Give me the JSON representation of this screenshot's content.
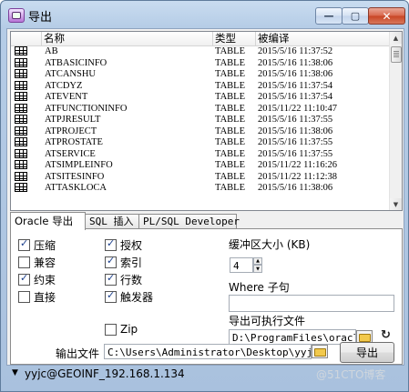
{
  "window": {
    "title": "导出",
    "min_glyph": "—",
    "max_glyph": "▢",
    "close_glyph": "✕"
  },
  "table": {
    "columns": [
      "名称",
      "类型",
      "被编译"
    ],
    "rows": [
      {
        "name": "AB",
        "type": "TABLE",
        "compiled": "2015/5/16 11:37:52"
      },
      {
        "name": "ATBASICINFO",
        "type": "TABLE",
        "compiled": "2015/5/16 11:38:06"
      },
      {
        "name": "ATCANSHU",
        "type": "TABLE",
        "compiled": "2015/5/16 11:38:06"
      },
      {
        "name": "ATCDYZ",
        "type": "TABLE",
        "compiled": "2015/5/16 11:37:54"
      },
      {
        "name": "ATEVENT",
        "type": "TABLE",
        "compiled": "2015/5/16 11:37:54"
      },
      {
        "name": "ATFUNCTIONINFO",
        "type": "TABLE",
        "compiled": "2015/11/22 11:10:47"
      },
      {
        "name": "ATPJRESULT",
        "type": "TABLE",
        "compiled": "2015/5/16 11:37:55"
      },
      {
        "name": "ATPROJECT",
        "type": "TABLE",
        "compiled": "2015/5/16 11:38:06"
      },
      {
        "name": "ATPROSTATE",
        "type": "TABLE",
        "compiled": "2015/5/16 11:37:55"
      },
      {
        "name": "ATSERVICE",
        "type": "TABLE",
        "compiled": "2015/5/16 11:37:55"
      },
      {
        "name": "ATSIMPLEINFO",
        "type": "TABLE",
        "compiled": "2015/11/22 11:16:26"
      },
      {
        "name": "ATSITESINFO",
        "type": "TABLE",
        "compiled": "2015/11/22 11:12:38"
      },
      {
        "name": "ATTASKLOCA",
        "type": "TABLE",
        "compiled": "2015/5/16 11:38:06"
      }
    ]
  },
  "tabs": [
    "Oracle 导出",
    "SQL 插入",
    "PL/SQL Developer"
  ],
  "options": {
    "compress": {
      "label": "压缩",
      "checked": true
    },
    "compatible": {
      "label": "兼容",
      "checked": false
    },
    "constraints": {
      "label": "约束",
      "checked": true
    },
    "direct": {
      "label": "直接",
      "checked": false
    },
    "grants": {
      "label": "授权",
      "checked": true
    },
    "indexes": {
      "label": "索引",
      "checked": true
    },
    "rows": {
      "label": "行数",
      "checked": true
    },
    "triggers": {
      "label": "触发器",
      "checked": true
    },
    "zip": {
      "label": "Zip",
      "checked": false
    }
  },
  "buffer": {
    "label": "缓冲区大小 (KB)",
    "value": "4"
  },
  "where": {
    "label": "Where 子句",
    "value": ""
  },
  "executable": {
    "label": "导出可执行文件",
    "value": "D:\\ProgramFiles\\oracle\\"
  },
  "output": {
    "label": "输出文件",
    "value": "C:\\Users\\Administrator\\Desktop\\yyjc.dr"
  },
  "export_button": "导出",
  "status": {
    "connection": "yyjc@GEOINF_192.168.1.134"
  },
  "watermark": "@51CTO博客"
}
